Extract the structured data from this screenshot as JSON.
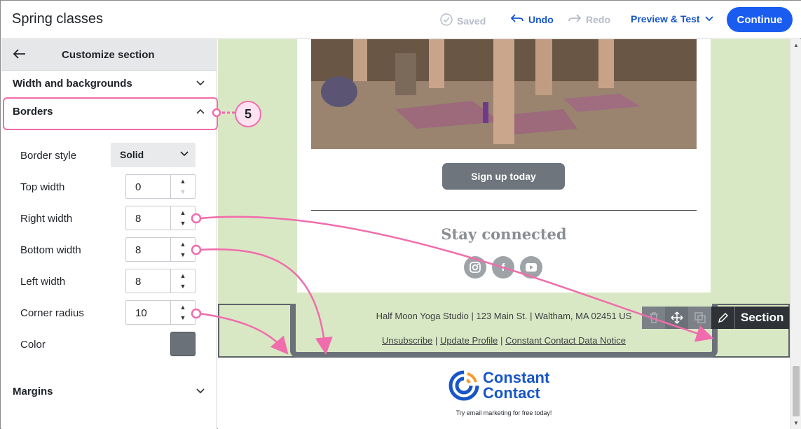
{
  "app": {
    "title": "Spring classes"
  },
  "topbar": {
    "saved": "Saved",
    "undo": "Undo",
    "redo": "Redo",
    "preview": "Preview & Test",
    "continue": "Continue"
  },
  "sidebar": {
    "title": "Customize section",
    "sections": {
      "width_backgrounds": "Width and backgrounds",
      "borders": "Borders",
      "margins": "Margins"
    },
    "border_style": {
      "label": "Border style",
      "value": "Solid"
    },
    "fields": [
      {
        "label": "Top width",
        "value": "0"
      },
      {
        "label": "Right width",
        "value": "8"
      },
      {
        "label": "Bottom width",
        "value": "8"
      },
      {
        "label": "Left width",
        "value": "8"
      },
      {
        "label": "Corner radius",
        "value": "10"
      }
    ],
    "color": {
      "label": "Color",
      "value": "#6b7178"
    }
  },
  "email": {
    "button": "Sign up today",
    "stay_connected": "Stay connected",
    "social_icons": [
      "instagram-icon",
      "facebook-icon",
      "youtube-icon"
    ],
    "footer": {
      "address": "Half Moon Yoga Studio | 123 Main St. | Waltham, MA 02451 US",
      "link_unsubscribe": "Unsubscribe",
      "link_update": "Update Profile",
      "link_notice": "Constant Contact Data Notice",
      "sep": "|"
    },
    "toolbar": {
      "section": "Section"
    },
    "logo": {
      "line1": "Constant",
      "line2": "Contact"
    },
    "tagline": "Try email marketing for free today!"
  },
  "annotation": {
    "step": "5",
    "color": "#f06cac"
  }
}
